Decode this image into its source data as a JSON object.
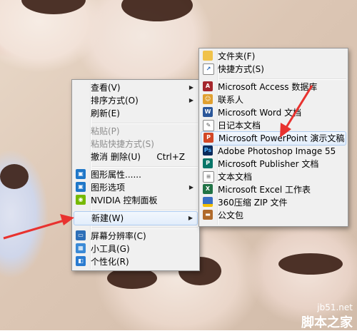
{
  "context_menu": {
    "items": [
      {
        "label": "查看(V)",
        "submenu": true
      },
      {
        "label": "排序方式(O)",
        "submenu": true
      },
      {
        "label": "刷新(E)"
      },
      {
        "label": "粘贴(P)",
        "disabled": true
      },
      {
        "label": "粘贴快捷方式(S)",
        "disabled": true
      },
      {
        "label": "撤消 删除(U)",
        "shortcut": "Ctrl+Z"
      },
      {
        "label": "图形属性......",
        "icon": "intel-graphics-icon"
      },
      {
        "label": "图形选项",
        "icon": "intel-graphics-icon",
        "submenu": true
      },
      {
        "label": "NVIDIA 控制面板",
        "icon": "nvidia-icon"
      },
      {
        "label": "新建(W)",
        "submenu": true,
        "highlighted": true
      },
      {
        "label": "屏幕分辨率(C)",
        "icon": "display-icon"
      },
      {
        "label": "小工具(G)",
        "icon": "gadgets-icon"
      },
      {
        "label": "个性化(R)",
        "icon": "personalize-icon"
      }
    ]
  },
  "new_submenu": {
    "items": [
      {
        "label": "文件夹(F)",
        "icon": "folder-icon"
      },
      {
        "label": "快捷方式(S)",
        "icon": "shortcut-icon"
      },
      {
        "label": "Microsoft Access 数据库",
        "icon": "access-icon"
      },
      {
        "label": "联系人",
        "icon": "contact-icon"
      },
      {
        "label": "Microsoft Word 文档",
        "icon": "word-icon"
      },
      {
        "label": "日记本文档",
        "icon": "journal-icon"
      },
      {
        "label": "Microsoft PowerPoint 演示文稿",
        "icon": "powerpoint-icon",
        "highlighted": true
      },
      {
        "label": "Adobe Photoshop Image 55",
        "icon": "photoshop-icon"
      },
      {
        "label": "Microsoft Publisher 文档",
        "icon": "publisher-icon"
      },
      {
        "label": "文本文档",
        "icon": "text-document-icon"
      },
      {
        "label": "Microsoft Excel 工作表",
        "icon": "excel-icon"
      },
      {
        "label": "360压缩 ZIP 文件",
        "icon": "zip-icon"
      },
      {
        "label": "公文包",
        "icon": "briefcase-icon"
      }
    ]
  },
  "watermark": {
    "site": "jb51.net",
    "brand": "脚本之家"
  },
  "colors": {
    "highlight": "#e2edfb",
    "highlight_border": "#aeccf1",
    "arrow": "#e8322f",
    "menu_bg": "#f0f0f0"
  }
}
